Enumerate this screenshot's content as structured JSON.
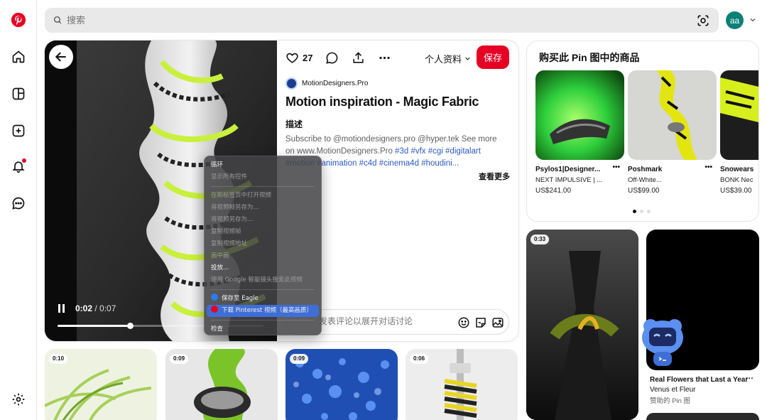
{
  "sidebar": {
    "items": [
      {
        "icon": "pinterest-logo-icon"
      },
      {
        "icon": "home-icon"
      },
      {
        "icon": "explore-icon"
      },
      {
        "icon": "create-icon"
      },
      {
        "icon": "notifications-icon"
      },
      {
        "icon": "messages-icon"
      },
      {
        "icon": "settings-icon"
      }
    ]
  },
  "search": {
    "placeholder": "搜索"
  },
  "user": {
    "initials": "aa",
    "color": "#0b8077"
  },
  "colors": {
    "brand": "#e60023",
    "link": "#2b59c3",
    "highlight": "#3e6ed6"
  },
  "pin": {
    "like_count": "27",
    "profile_menu": "个人资料",
    "save_label": "保存",
    "creator": "MotionDesigners.Pro",
    "title": "Motion inspiration - Magic Fabric",
    "desc_heading": "描述",
    "desc_text": "Subscribe to @motiondesigners.pro @hyper.tek See more on www.MotionDesigners.Pro",
    "hashtags": [
      "#3d",
      "#vfx",
      "#cgi",
      "#digitalart",
      "#motion",
      "#animation",
      "#c4d",
      "#cinema4d",
      "#houdini..."
    ],
    "see_more": "查看更多",
    "comment_placeholder": "发表评论以展开对话讨论",
    "video": {
      "current": "0:02",
      "total": "/ 0:07",
      "progress": 0.35
    }
  },
  "context_menu": {
    "items": [
      {
        "label": "循环",
        "enabled": true
      },
      {
        "label": "显示所有控件",
        "enabled": false
      },
      {
        "label": "在新标签页中打开视频",
        "enabled": false
      },
      {
        "label": "将视频帧另存为...",
        "enabled": false
      },
      {
        "label": "将视频另存为...",
        "enabled": false
      },
      {
        "label": "复制视频帧",
        "enabled": false
      },
      {
        "label": "复制视频地址",
        "enabled": false
      },
      {
        "label": "画中画",
        "enabled": false
      },
      {
        "label": "投放...",
        "enabled": true
      },
      {
        "label": "使用 Google 智能镜头搜索此视频",
        "enabled": false
      },
      {
        "label": "保存至 Eagle",
        "enabled": true
      },
      {
        "label": "下载 Pinterest 视频（最高画质）",
        "enabled": true,
        "highlighted": true
      },
      {
        "label": "检查",
        "enabled": true
      }
    ]
  },
  "shop": {
    "title": "购买此 Pin 图中的商品",
    "products": [
      {
        "name": "Psylos1|Designer...",
        "sub": "NEXT IMPULSIVE | ...",
        "price": "US$241.00"
      },
      {
        "name": "Poshmark",
        "sub": "Off-White...",
        "price": "US$99.00"
      },
      {
        "name": "Snowears",
        "sub": "BONK Nec",
        "price": "US$39.00"
      }
    ],
    "page_count": 3,
    "active_page": 1
  },
  "grid": {
    "badges": [
      "0:10",
      "0:09",
      "0:09",
      "0:06",
      "0:33"
    ]
  },
  "right_pin": {
    "title": "Real Flowers that Last a Year",
    "subtitle": "Venus et Fleur",
    "sponsored": "赞助的 Pin 图"
  }
}
